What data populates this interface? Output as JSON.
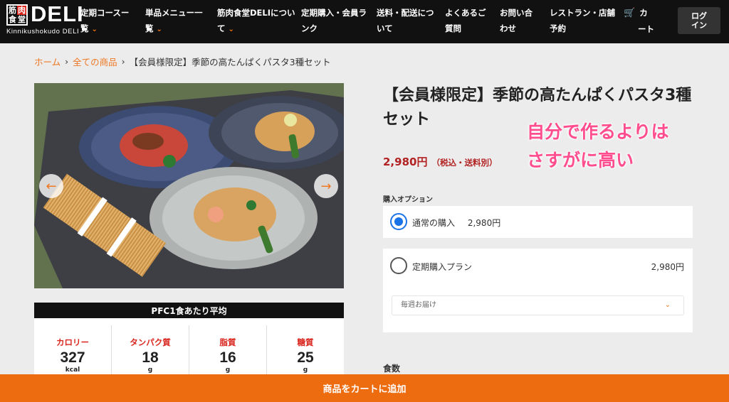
{
  "header": {
    "logo_kanji": [
      "筋",
      "肉",
      "食",
      "堂"
    ],
    "logo_text": "DELI",
    "logo_sub": "Kinnikushokudo DELI",
    "nav": [
      {
        "line1": "定期コースー",
        "line2": "覧",
        "chevron": true
      },
      {
        "line1": "単品メニュー一",
        "line2": "覧",
        "chevron": true
      },
      {
        "line1": "筋肉食堂DELIについ",
        "line2": "て",
        "chevron": true
      },
      {
        "line1": "定期購入・会員ラ",
        "line2": "ンク",
        "chevron": false
      },
      {
        "line1": "送料・配送につ",
        "line2": "いて",
        "chevron": false
      },
      {
        "line1": "よくあるご",
        "line2": "質問",
        "chevron": false
      },
      {
        "line1": "お問い合",
        "line2": "わせ",
        "chevron": false
      },
      {
        "line1": "レストラン・店舗",
        "line2": "予約",
        "chevron": false
      },
      {
        "line1": "カ",
        "line2": "ート",
        "chevron": false
      }
    ],
    "login_line1": "ログ",
    "login_line2": "イン"
  },
  "breadcrumb": {
    "home": "ホーム",
    "all": "全ての商品",
    "current": "【会員様限定】季節の高たんぱくパスタ3種セット",
    "sep": "›"
  },
  "product": {
    "title": "【会員様限定】季節の高たんぱくパスタ3種セット",
    "price": "2,980円",
    "tax_note": "（税込・送料別）",
    "overlay_line1": "自分で作るよりは",
    "overlay_line2": "さすがに高い"
  },
  "pfc": {
    "header": "PFC1食あたり平均",
    "items": [
      {
        "label": "カロリー",
        "value": "327",
        "unit": "kcal"
      },
      {
        "label": "タンパク質",
        "value": "18",
        "unit": "g"
      },
      {
        "label": "脂質",
        "value": "16",
        "unit": "g"
      },
      {
        "label": "糖質",
        "value": "25",
        "unit": "g"
      }
    ]
  },
  "purchase": {
    "options_label": "購入オプション",
    "normal_label": "通常の購入",
    "normal_price": "2,980円",
    "subscription_label": "定期購入プラン",
    "subscription_price": "2,980円",
    "frequency_selected": "毎週お届け",
    "quantity_label": "食数",
    "add_to_cart": "商品をカートに追加"
  },
  "colors": {
    "accent": "#ee7722",
    "overlay": "#ff4d8d",
    "price": "#b22222",
    "radio": "#1a73e8"
  }
}
